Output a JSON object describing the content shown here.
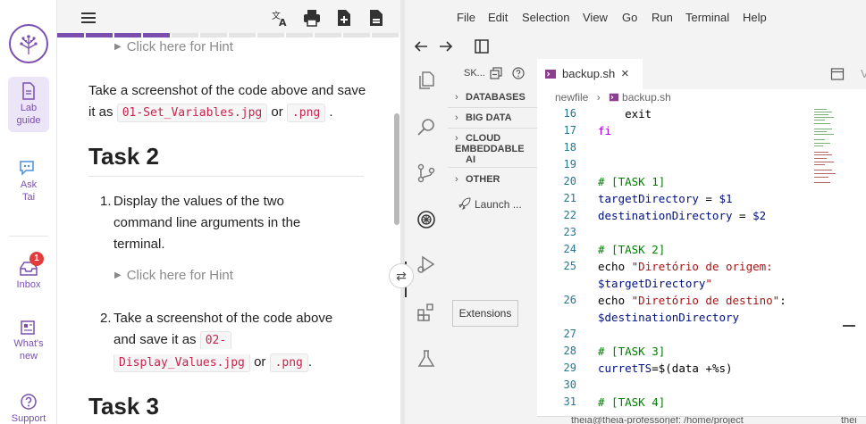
{
  "rail": {
    "items": [
      {
        "label_1": "Lab",
        "label_2": "guide"
      },
      {
        "label_1": "Ask",
        "label_2": "Tai"
      },
      {
        "label_1": "Inbox",
        "badge": "1"
      },
      {
        "label_1": "What's",
        "label_2": "new"
      },
      {
        "label_1": "Support"
      }
    ]
  },
  "lab": {
    "hint_1": "Click here for Hint",
    "para_1": {
      "text_a": "Take a screenshot of the code above and save",
      "text_b": "it as",
      "code_1": "01-Set_Variables.jpg",
      "or": "or",
      "code_2": ".png",
      "end": "."
    },
    "task_2_title": "Task 2",
    "item_1": {
      "num": "1.",
      "line_1": "Display the values of the two",
      "line_2": "command line arguments in the",
      "line_3": "terminal."
    },
    "hint_2": "Click here for Hint",
    "item_2": {
      "num": "2.",
      "line_1": "Take a screenshot of the code above",
      "line_2": "and save it as",
      "code_1a": "02-",
      "code_1b": "Display_Values.jpg",
      "or": "or",
      "code_2": ".png",
      "end": "."
    },
    "task_3_title": "Task 3",
    "progress_colors": [
      "#7b4fb0",
      "#7b4fb0",
      "#7b4fb0",
      "#7b4fb0",
      "#e4e4e4",
      "#e4e4e4",
      "#e4e4e4",
      "#e4e4e4",
      "#e4e4e4",
      "#e4e4e4",
      "#e4e4e4",
      "#e4e4e4"
    ]
  },
  "ide": {
    "menu": [
      "File",
      "Edit",
      "Selection",
      "View",
      "Go",
      "Run",
      "Terminal",
      "Help"
    ],
    "sidebar": {
      "title": "SK...",
      "items": [
        "DATABASES",
        "BIG DATA",
        "CLOUD",
        "EMBEDDABLE",
        "AI",
        "OTHER"
      ],
      "launch": "Launch ..."
    },
    "tooltip": "Extensions",
    "tab": {
      "name": "backup.sh",
      "close": "×"
    },
    "breadcrumb": {
      "folder": "newfile",
      "sep": "›",
      "file": "backup.sh"
    },
    "status": "theia@theia-professorjef: /home/project",
    "status_2": "thei",
    "code_lines": [
      {
        "n": "16",
        "parts": [
          {
            "t": "    exit",
            "c": ""
          }
        ]
      },
      {
        "n": "17",
        "parts": [
          {
            "t": "fi",
            "c": "kw"
          }
        ]
      },
      {
        "n": "18",
        "parts": []
      },
      {
        "n": "19",
        "parts": []
      },
      {
        "n": "20",
        "parts": [
          {
            "t": "# [TASK 1]",
            "c": "cm"
          }
        ]
      },
      {
        "n": "21",
        "parts": [
          {
            "t": "targetDirectory",
            "c": "var"
          },
          {
            "t": " = ",
            "c": ""
          },
          {
            "t": "$1",
            "c": "var"
          }
        ]
      },
      {
        "n": "22",
        "parts": [
          {
            "t": "destinationDirectory",
            "c": "var"
          },
          {
            "t": " = ",
            "c": ""
          },
          {
            "t": "$2",
            "c": "var"
          }
        ]
      },
      {
        "n": "23",
        "parts": []
      },
      {
        "n": "24",
        "parts": [
          {
            "t": "# [TASK 2]",
            "c": "cm"
          }
        ]
      },
      {
        "n": "25",
        "parts": [
          {
            "t": "echo ",
            "c": ""
          },
          {
            "t": "\"Diretório de origem:",
            "c": "str"
          }
        ]
      },
      {
        "n": "",
        "parts": [
          {
            "t": "$targetDirectory",
            "c": "var"
          },
          {
            "t": "\"",
            "c": "str"
          }
        ]
      },
      {
        "n": "26",
        "parts": [
          {
            "t": "echo ",
            "c": ""
          },
          {
            "t": "\"Diretório de destino\"",
            "c": "str"
          },
          {
            "t": ":",
            "c": ""
          }
        ]
      },
      {
        "n": "",
        "parts": [
          {
            "t": "$destinationDirectory",
            "c": "var"
          }
        ]
      },
      {
        "n": "27",
        "parts": []
      },
      {
        "n": "28",
        "parts": [
          {
            "t": "# [TASK 3]",
            "c": "cm"
          }
        ]
      },
      {
        "n": "29",
        "parts": [
          {
            "t": "curretTS",
            "c": "var"
          },
          {
            "t": "=$(",
            "c": ""
          },
          {
            "t": "data",
            "c": ""
          },
          {
            "t": " +%s)",
            "c": ""
          }
        ]
      },
      {
        "n": "30",
        "parts": []
      },
      {
        "n": "31",
        "parts": [
          {
            "t": "# [TASK 4]",
            "c": "cm"
          }
        ]
      }
    ]
  }
}
